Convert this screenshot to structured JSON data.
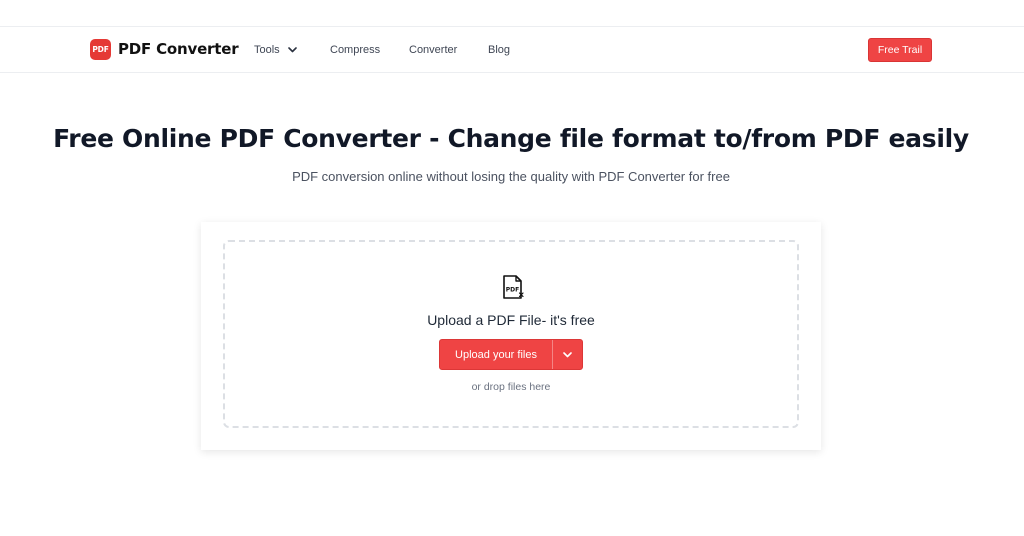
{
  "brand": {
    "logo_text": "PDF",
    "name": "PDF Converter"
  },
  "nav": {
    "tools": "Tools",
    "compress": "Compress",
    "converter": "Converter",
    "blog": "Blog",
    "cta": "Free Trail"
  },
  "hero": {
    "title": "Free Online PDF Converter - Change file format to/from PDF easily",
    "subtitle": "PDF conversion online without losing the quality with PDF Converter for free"
  },
  "upload": {
    "icon": "pdf-file-icon",
    "title": "Upload a PDF File- it's free",
    "button_label": "Upload your files",
    "hint": "or drop files here"
  },
  "colors": {
    "accent": "#ef4444",
    "text": "#111827",
    "muted": "#4b5260",
    "border": "#dcdfe4"
  }
}
